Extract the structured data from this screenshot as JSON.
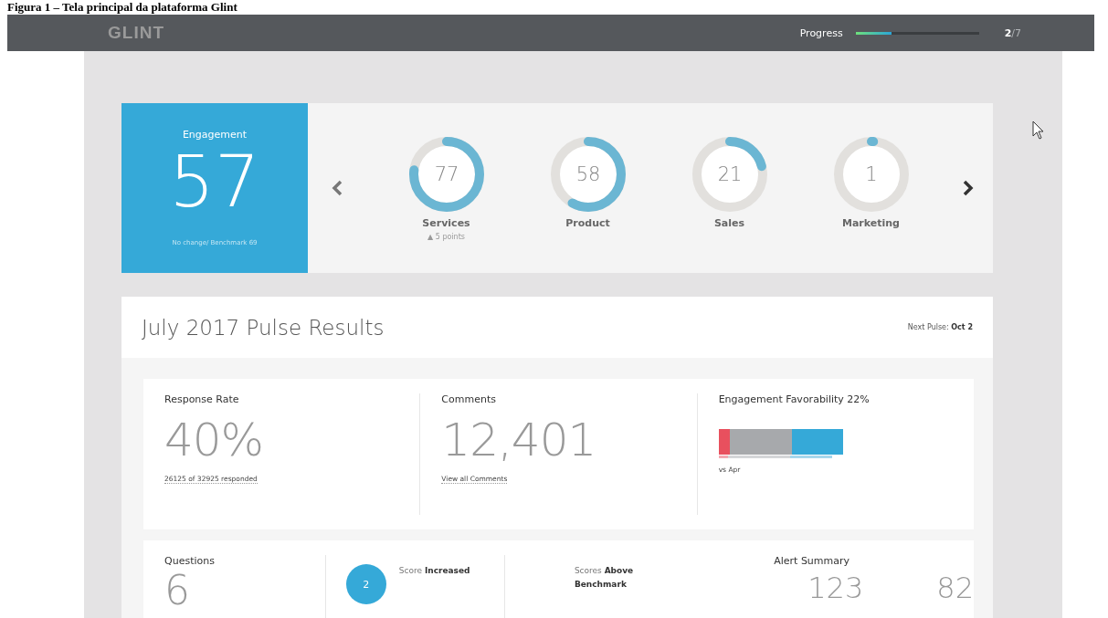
{
  "caption": "Figura 1 – Tela principal da plataforma Glint",
  "topbar": {
    "logo": "GLINT",
    "progress": {
      "label": "Progress",
      "level": 0.29,
      "count": "**2**/7"
    }
  },
  "engagement": {
    "label": "Engagement",
    "score": "57",
    "note": "No change/ Benchmark 69"
  },
  "groups": [
    {
      "name": "Services",
      "score": "77",
      "level": 0.77,
      "change": "▲ 5 points"
    },
    {
      "name": "Product",
      "score": "58",
      "level": 0.58
    },
    {
      "name": "Sales",
      "score": "21",
      "level": 0.21
    },
    {
      "name": "Marketing",
      "score": "1",
      "level": 0.01
    }
  ],
  "pulse": {
    "title": "July 2017 Pulse Results",
    "next_label": "Next Pulse:",
    "next_date": "Oct 2"
  },
  "stats": [
    {
      "kind": "number",
      "label": "Response Rate",
      "value": "40%",
      "sub": "26125 of 32925 responded"
    },
    {
      "kind": "number",
      "label": "Comments",
      "value": "12,401",
      "sub": "View all Comments"
    },
    {
      "kind": "bars",
      "label": "Engagement Favorability 22%",
      "sub": "vs Apr"
    }
  ],
  "questions": {
    "label": "Questions",
    "value": "6",
    "increased_count": "2",
    "increased_text": "Score **Increased**",
    "above_text": "Scores **Above Benchmark**"
  },
  "alerts": {
    "label": "Alert Summary",
    "values": [
      "123",
      "82"
    ]
  }
}
